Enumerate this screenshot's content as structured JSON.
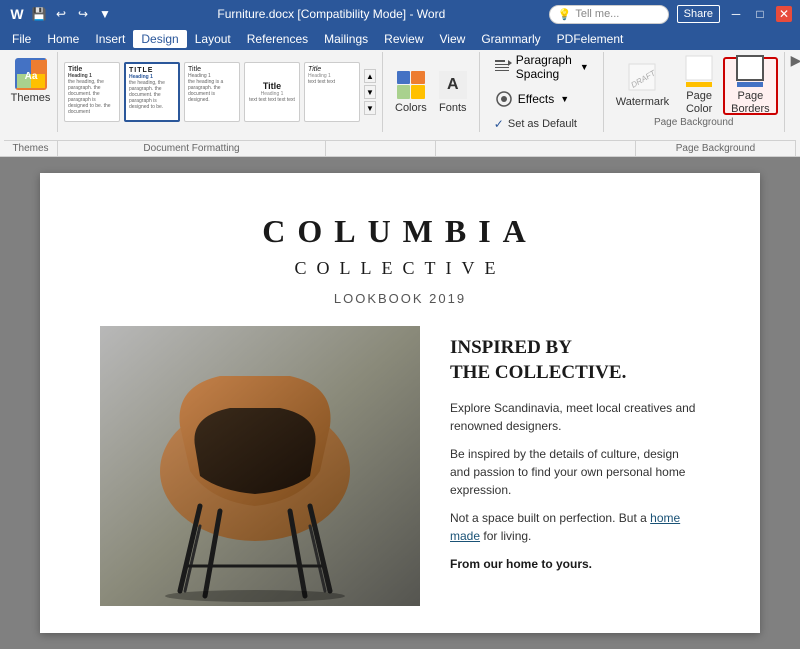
{
  "titlebar": {
    "title": "Furniture.docx [Compatibility Mode] - Word",
    "min_btn": "─",
    "max_btn": "□",
    "close_btn": "✕",
    "word_icon": "W"
  },
  "menubar": {
    "items": [
      "File",
      "Home",
      "Insert",
      "Design",
      "Layout",
      "References",
      "Mailings",
      "Review",
      "View",
      "Grammarly",
      "PDFelement"
    ]
  },
  "ribbon": {
    "themes_label": "Themes",
    "doc_format_label": "Document Formatting",
    "colors_label": "Colors",
    "fonts_label": "Fonts",
    "para_spacing_label": "Paragraph Spacing",
    "effects_label": "Effects",
    "set_default_label": "Set as Default",
    "watermark_label": "Watermark",
    "page_color_label": "Page\nColor",
    "page_borders_label": "Page\nBorders",
    "page_background_label": "Page Background",
    "tell_me_label": "Tell me...",
    "sign_in_label": "Share"
  },
  "document": {
    "title": "COLUMBIA",
    "subtitle": "COLLECTIVE",
    "lookbook": "LOOKBOOK 2019",
    "heading": "INSPIRED BY\nTHE COLLECTIVE.",
    "para1": "Explore Scandinavia, meet local creatives\nand renowned designers.",
    "para2": "Be inspired by the details of culture,\ndesign and passion to find your own\npersonal home expression.",
    "para3": "Not a space built on perfection. But a",
    "link_text": "home made",
    "para3_end": "for living.",
    "para4": "From our home to yours."
  },
  "colors": {
    "accent1": "#4472c4",
    "accent2": "#ed7d31",
    "accent3": "#a9d18e",
    "accent4": "#ffc000",
    "highlight": "#c00000"
  }
}
